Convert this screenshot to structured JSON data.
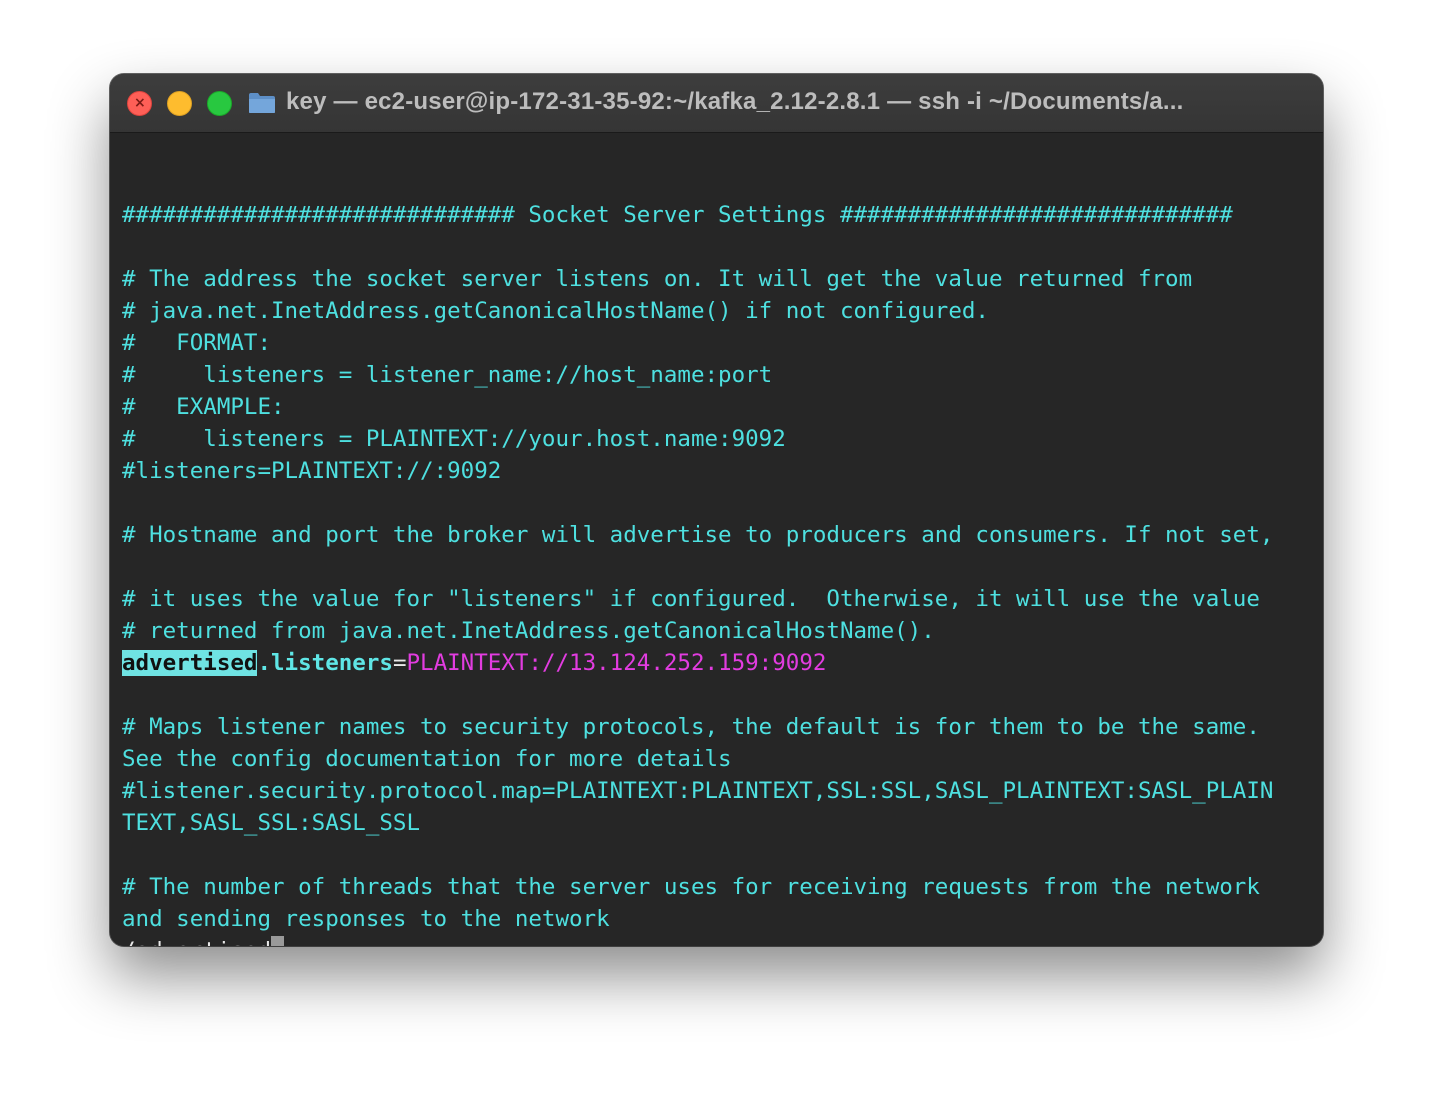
{
  "window": {
    "title": "key — ec2-user@ip-172-31-35-92:~/kafka_2.12-2.8.1 — ssh -i ~/Documents/a..."
  },
  "icons": {
    "close": "close-icon",
    "minimize": "minimize-icon",
    "maximize": "maximize-icon",
    "folder": "folder-icon"
  },
  "colors": {
    "terminal_bg": "#262626",
    "comment_text": "#4ee0e0",
    "search_highlight": "#6fe3e3",
    "value_text": "#e23ce0",
    "plain_text": "#e9e9e9"
  },
  "terminal": {
    "lines": [
      "",
      "############################# Socket Server Settings #############################",
      "",
      "# The address the socket server listens on. It will get the value returned from",
      "# java.net.InetAddress.getCanonicalHostName() if not configured.",
      "#   FORMAT:",
      "#     listeners = listener_name://host_name:port",
      "#   EXAMPLE:",
      "#     listeners = PLAINTEXT://your.host.name:9092",
      "#listeners=PLAINTEXT://:9092",
      "",
      "# Hostname and port the broker will advertise to producers and consumers. If not set,",
      "",
      "# it uses the value for \"listeners\" if configured.  Otherwise, it will use the value",
      "# returned from java.net.InetAddress.getCanonicalHostName().",
      "",
      "",
      "# Maps listener names to security protocols, the default is for them to be the same.",
      "See the config documentation for more details",
      "#listener.security.protocol.map=PLAINTEXT:PLAINTEXT,SSL:SSL,SASL_PLAINTEXT:SASL_PLAIN",
      "TEXT,SASL_SSL:SASL_SSL",
      "",
      "# The number of threads that the server uses for receiving requests from the network",
      "and sending responses to the network"
    ],
    "setting": {
      "match": "advertised",
      "key_rest": ".listeners",
      "equals": "=",
      "value": "PLAINTEXT://13.124.252.159:9092"
    },
    "search_command": "/advertised"
  }
}
